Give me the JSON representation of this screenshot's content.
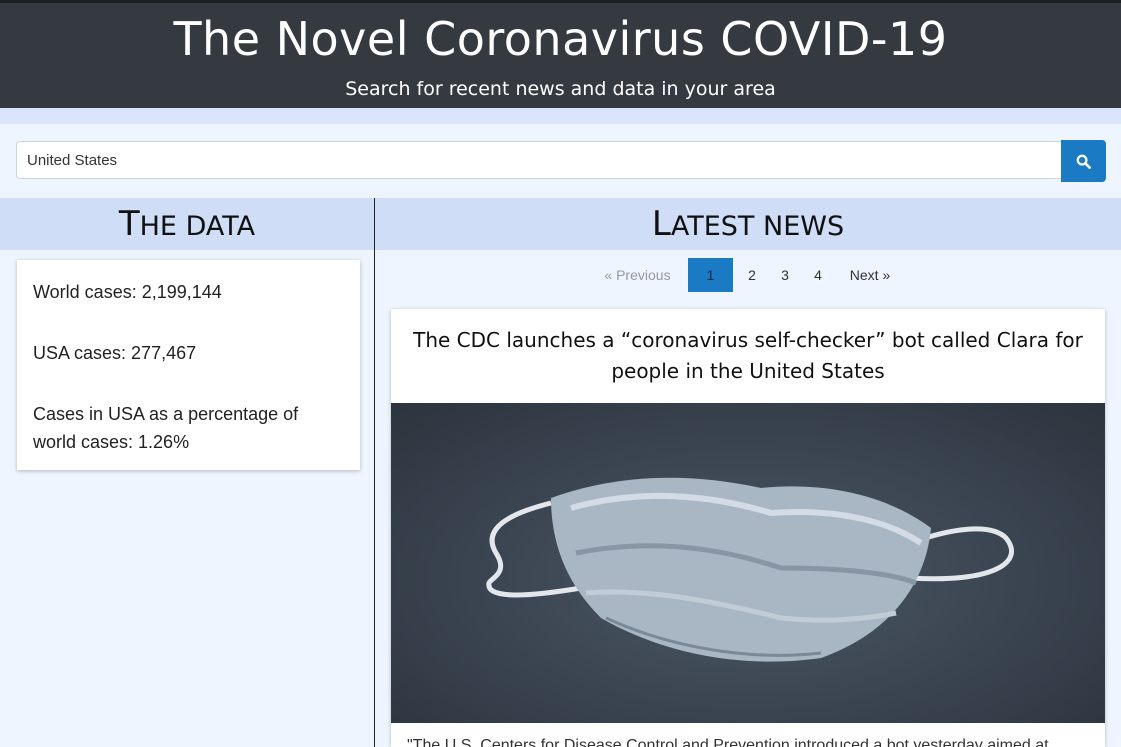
{
  "header": {
    "title": "The Novel Coronavirus COVID-19",
    "subtitle": "Search for recent news and data in your area"
  },
  "search": {
    "value": "United States",
    "button_icon": "search-icon"
  },
  "data_section": {
    "heading_first": "T",
    "heading_rest": "HE DATA",
    "stats": [
      "World cases: 2,199,144",
      "USA cases: 277,467",
      "Cases in USA as a percentage of world cases: 1.26%"
    ]
  },
  "news_section": {
    "heading_first": "L",
    "heading_rest": "ATEST NEWS",
    "pagination": {
      "previous": "«  Previous",
      "pages": [
        "1",
        "2",
        "3",
        "4"
      ],
      "active_page": "1",
      "next": "Next  »"
    },
    "article": {
      "title": "The CDC launches a “coronavirus self-checker” bot called Clara for people in the United States",
      "image": "surgical-mask-photo",
      "snippet": "\"The U.S. Centers for Disease Control and Prevention introduced a bot yesterday aimed at"
    }
  },
  "colors": {
    "header_bg": "#343a40",
    "accent": "#1a7bc4",
    "section_head_bg": "#cfddf7",
    "page_bg": "#eef5ff"
  }
}
